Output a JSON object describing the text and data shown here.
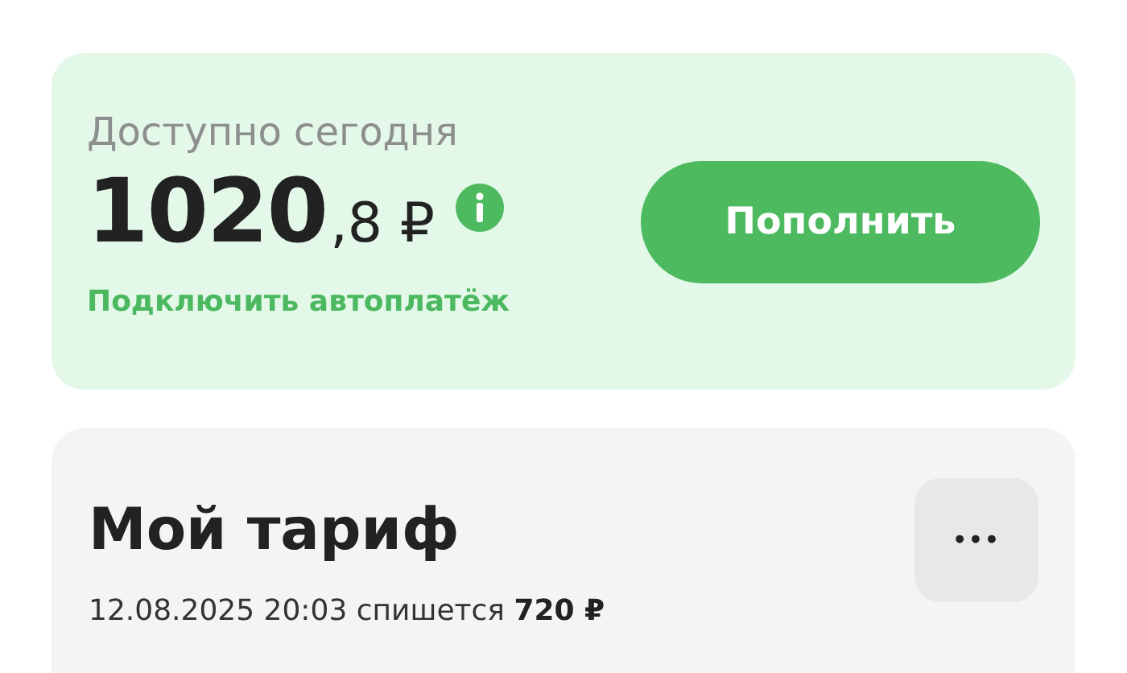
{
  "balance": {
    "label": "Доступно сегодня",
    "amount_whole": "1020",
    "amount_fraction": ",8 ₽",
    "autopay_link": "Подключить автоплатёж",
    "topup_button": "Пополнить"
  },
  "tariff": {
    "title": "Мой тариф",
    "charge_info": "12.08.2025 20:03 спишется **720 ₽**",
    "more_button": "•••"
  }
}
